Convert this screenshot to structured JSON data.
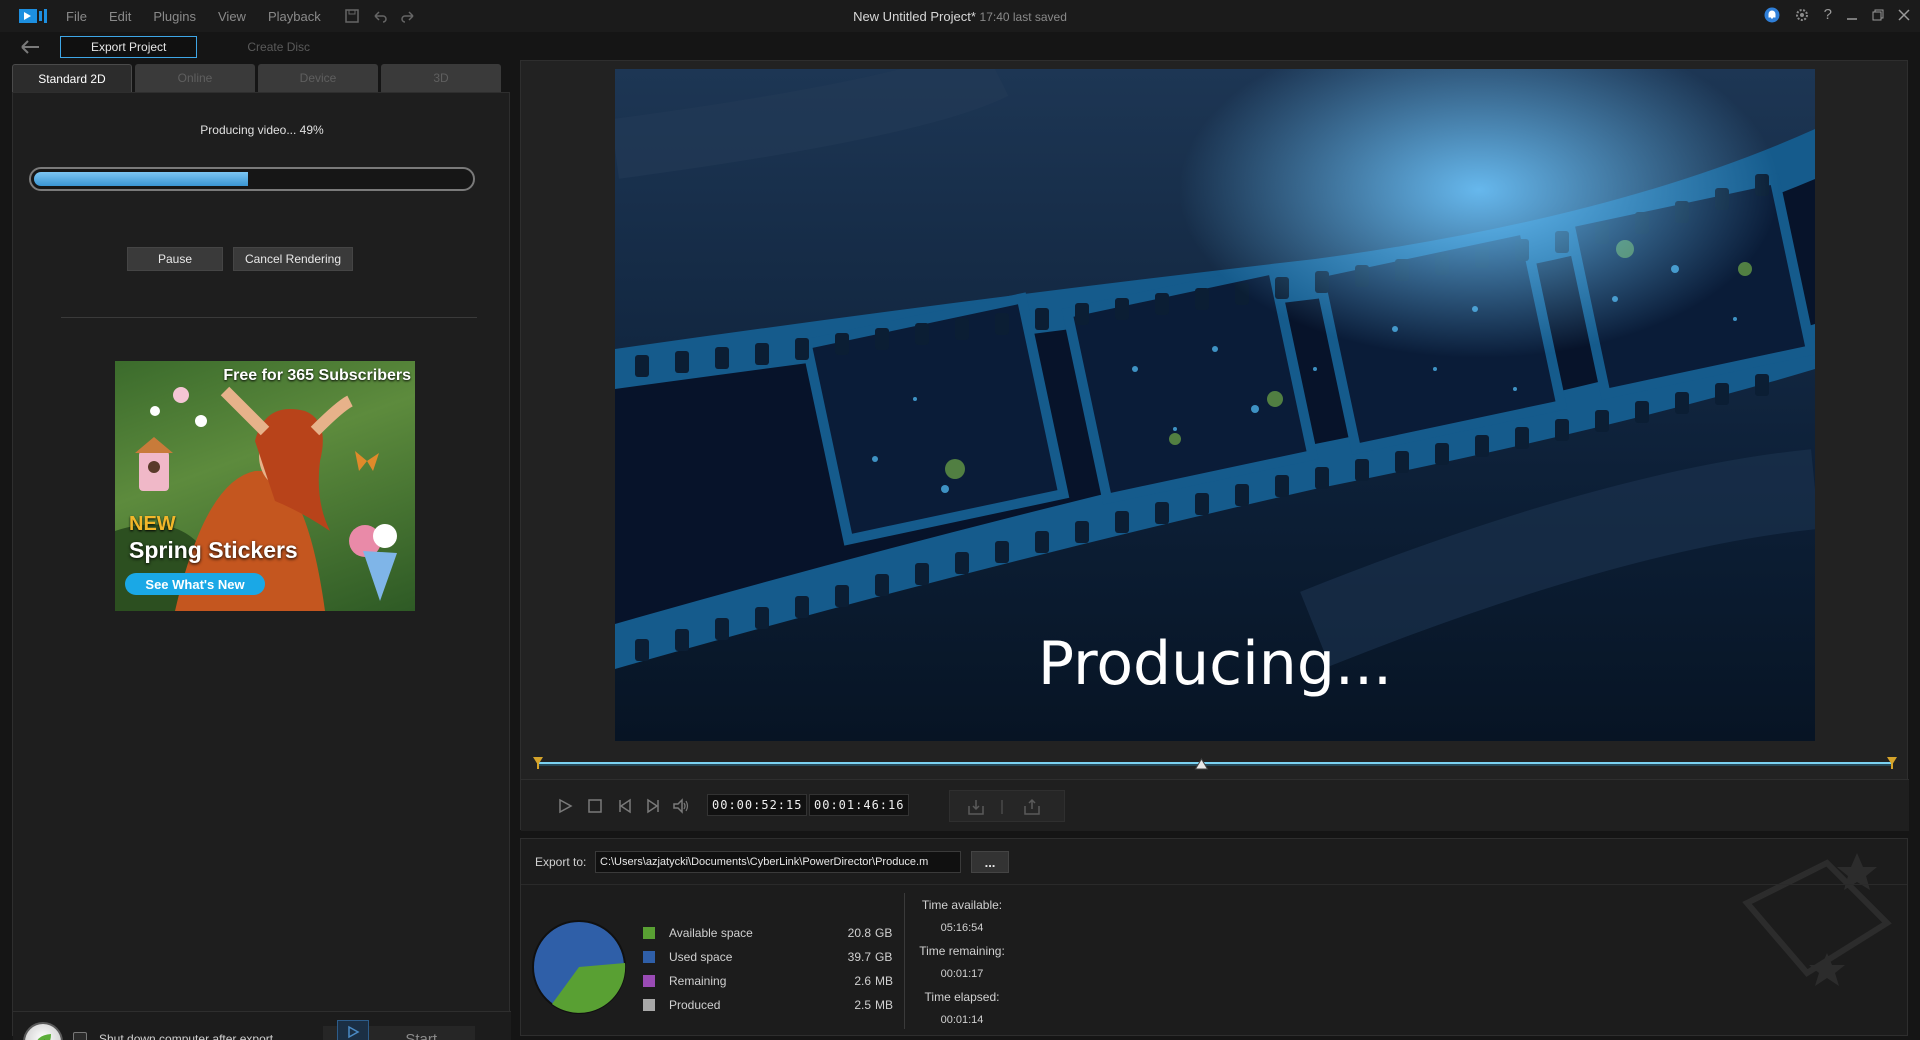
{
  "titlebar": {
    "menu": [
      "File",
      "Edit",
      "Plugins",
      "View",
      "Playback"
    ],
    "project_title": "New Untitled Project*",
    "saved_status": "17:40 last saved"
  },
  "modebar": {
    "export_project": "Export Project",
    "create_disc": "Create Disc"
  },
  "tabs": [
    "Standard 2D",
    "Online",
    "Device",
    "3D"
  ],
  "progress": {
    "status_text": "Producing video... 49%",
    "percent": 49,
    "pause_label": "Pause",
    "cancel_label": "Cancel Rendering"
  },
  "ad": {
    "headline": "Free for 365 Subscribers",
    "new_label": "NEW",
    "product": "Spring Stickers",
    "cta": "See What's New"
  },
  "bottom": {
    "shutdown_label": "Shut down computer after export",
    "start_label": "Start"
  },
  "preview": {
    "overlay_text": "Producing...",
    "timecode_current": "00:00:52:15",
    "timecode_total": "00:01:46:16",
    "playhead_fraction": 0.49
  },
  "export": {
    "label": "Export to:",
    "path": "C:\\Users\\azjatycki\\Documents\\CyberLink\\PowerDirector\\Produce.m",
    "browse_label": "..."
  },
  "disk": {
    "legend": [
      {
        "label": "Available space",
        "value": "20.8",
        "unit": "GB",
        "color": "#59a033"
      },
      {
        "label": "Used space",
        "value": "39.7",
        "unit": "GB",
        "color": "#2f5fa8"
      },
      {
        "label": "Remaining",
        "value": "2.6",
        "unit": "MB",
        "color": "#9a4bb5"
      },
      {
        "label": "Produced",
        "value": "2.5",
        "unit": "MB",
        "color": "#a8a8a8"
      }
    ]
  },
  "time": {
    "available_label": "Time available:",
    "available_value": "05:16:54",
    "remaining_label": "Time remaining:",
    "remaining_value": "00:01:17",
    "elapsed_label": "Time elapsed:",
    "elapsed_value": "00:01:14"
  }
}
